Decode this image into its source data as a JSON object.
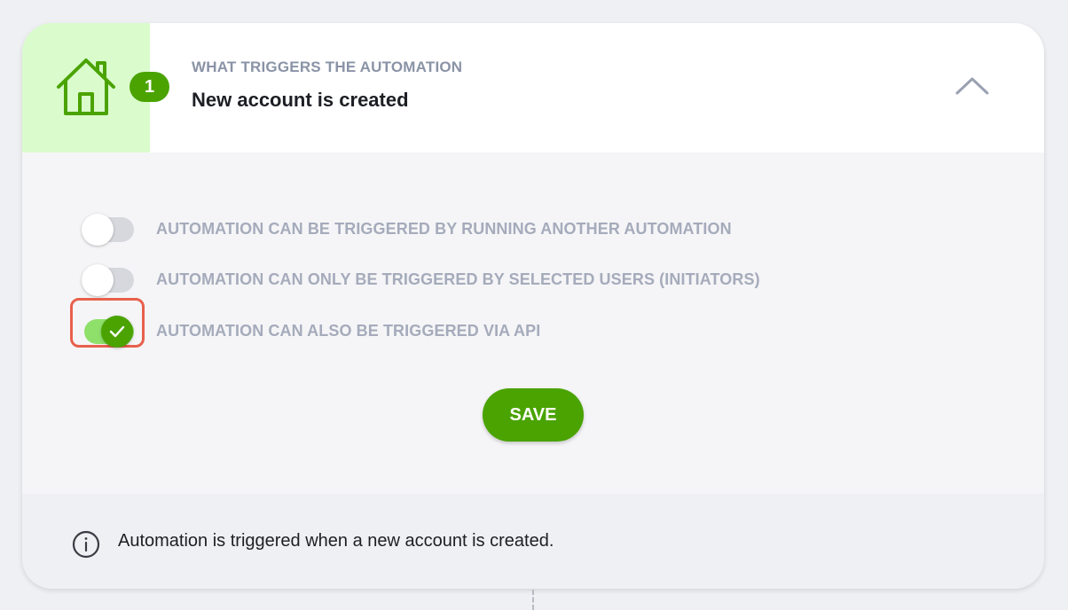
{
  "trigger": {
    "step_number": "1",
    "label": "WHAT TRIGGERS THE AUTOMATION",
    "title": "New account is created"
  },
  "icons": {
    "header_icon": "house-icon",
    "collapse_icon": "chevron-up-icon",
    "info_icon": "info-icon",
    "check_icon": "check-icon"
  },
  "options": [
    {
      "label": "AUTOMATION CAN BE TRIGGERED BY RUNNING ANOTHER AUTOMATION",
      "enabled": false
    },
    {
      "label": "AUTOMATION CAN ONLY BE TRIGGERED BY SELECTED USERS (INITIATORS)",
      "enabled": false
    },
    {
      "label": "AUTOMATION CAN ALSO BE TRIGGERED VIA API",
      "enabled": true
    }
  ],
  "save_label": "SAVE",
  "footer": {
    "info_text": "Automation is triggered when a new account is created."
  },
  "colors": {
    "accent": "#4aa300",
    "icon_cell_bg": "#dafbcc",
    "toggle_on_track": "#8fe06b",
    "highlight_border": "#e8604c"
  }
}
